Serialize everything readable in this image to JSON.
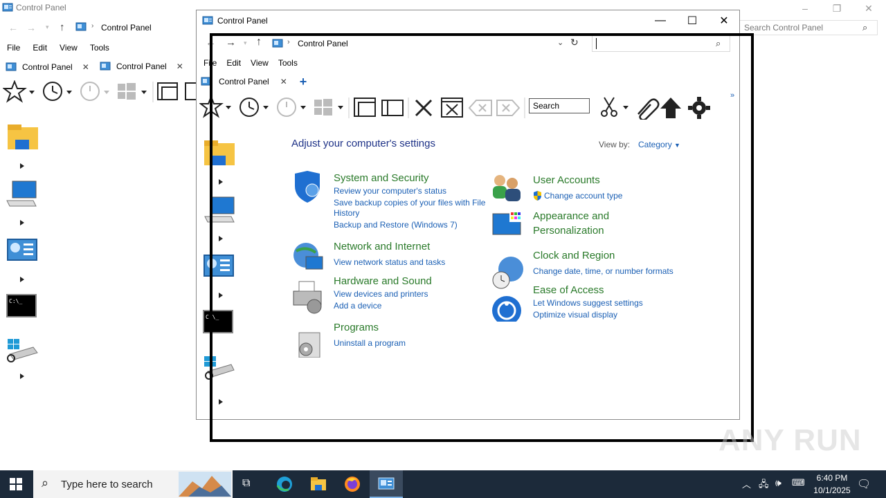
{
  "background_window": {
    "title": "Control Panel",
    "address": "Control Panel",
    "search_placeholder": "Search Control Panel",
    "menu": [
      "File",
      "Edit",
      "View",
      "Tools"
    ],
    "tabs": [
      {
        "label": "Control Panel"
      },
      {
        "label": "Control Panel"
      }
    ]
  },
  "window": {
    "title": "Control Panel",
    "address": "Control Panel",
    "search_value": "",
    "menu": [
      "File",
      "Edit",
      "View",
      "Tools"
    ],
    "tab_label": "Control Panel",
    "toolbar_search_placeholder": "Search"
  },
  "content": {
    "heading": "Adjust your computer's settings",
    "view_by_label": "View by:",
    "view_by_value": "Category",
    "categories": [
      {
        "title": "System and Security",
        "links": [
          "Review your computer's status",
          "Save backup copies of your files with File",
          "History",
          "Backup and Restore (Windows 7)"
        ]
      },
      {
        "title": "Network and Internet",
        "links": [
          "View network status and tasks"
        ]
      },
      {
        "title": "Hardware and Sound",
        "links": [
          "View devices and printers",
          "Add a device"
        ]
      },
      {
        "title": "Programs",
        "links": [
          "Uninstall a program"
        ]
      },
      {
        "title": "User Accounts",
        "links": [
          "Change account type"
        ]
      },
      {
        "title": "Appearance and",
        "title2": "Personalization",
        "links": []
      },
      {
        "title": "Clock and Region",
        "links": [
          "Change date, time, or number formats"
        ]
      },
      {
        "title": "Ease of Access",
        "links": [
          "Let Windows suggest settings",
          "Optimize visual display"
        ]
      }
    ]
  },
  "taskbar": {
    "search_placeholder": "Type here to search",
    "time": "6:40 PM",
    "date": "10/1/2025"
  },
  "watermark": "ANY RUN",
  "colors": {
    "link": "#1a5fb4",
    "category_title": "#2a7a2a",
    "heading": "#1e3287",
    "taskbar": "#1c2a3a"
  }
}
